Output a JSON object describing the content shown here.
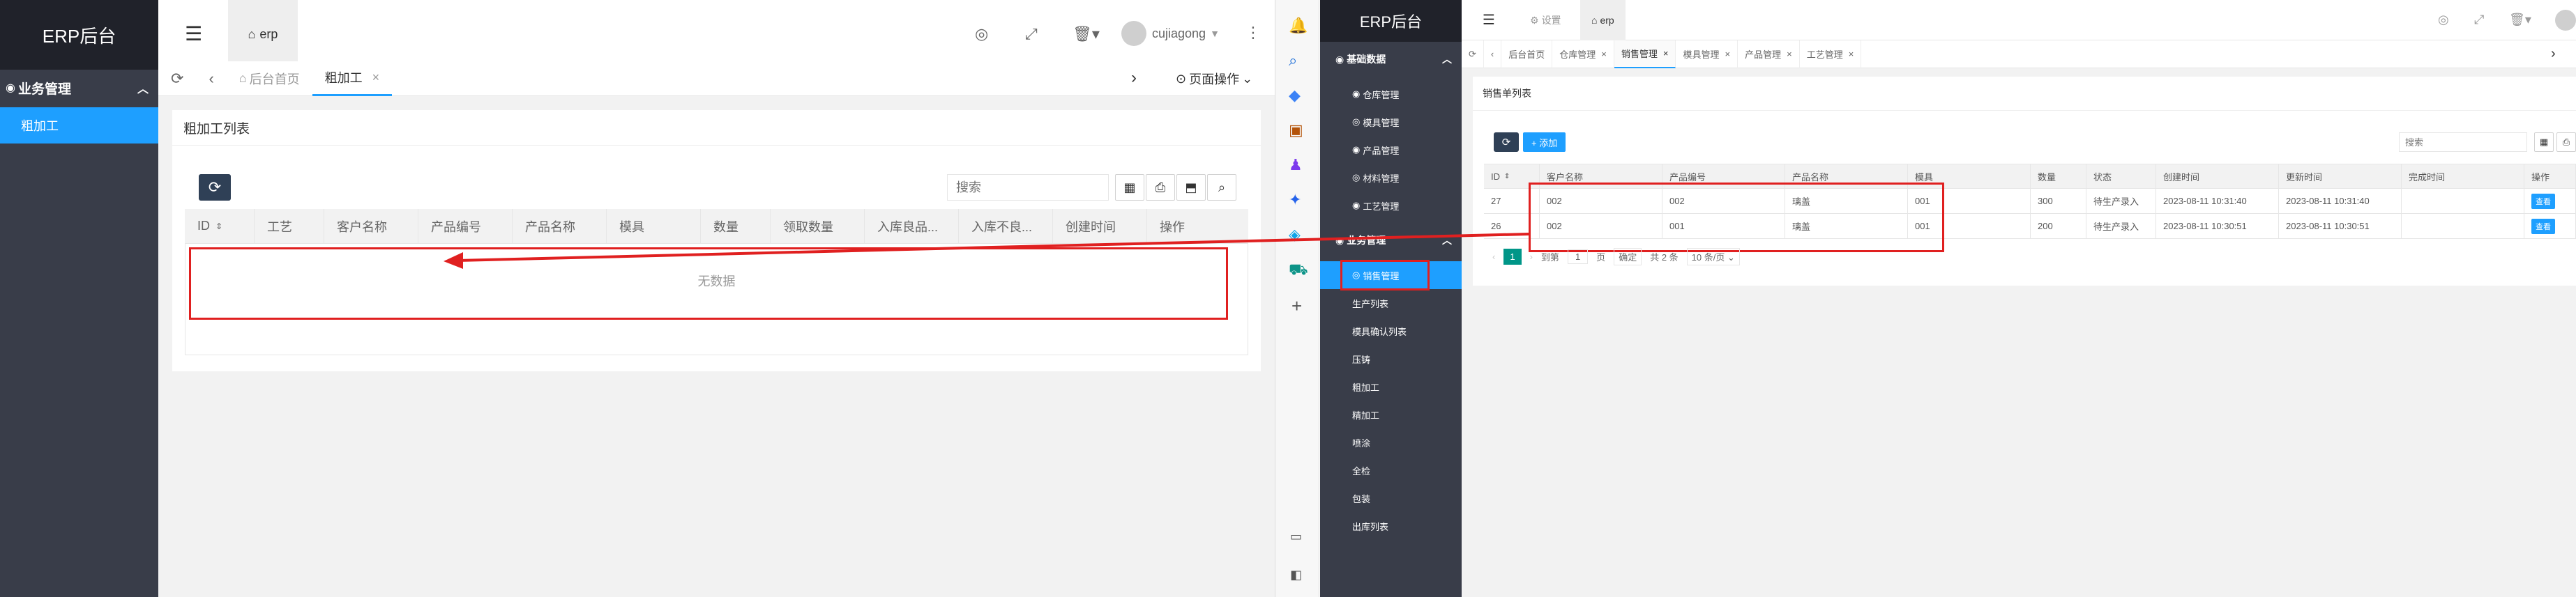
{
  "left": {
    "logo": "ERP后台",
    "sidebar": {
      "group_label": "业务管理",
      "active_item": "粗加工"
    },
    "header": {
      "top_tab": "erp",
      "user_name": "cujiagong"
    },
    "tabs": {
      "home": "后台首页",
      "current": "粗加工",
      "page_ops": "页面操作"
    },
    "card": {
      "title": "粗加工列表",
      "search_placeholder": "搜索"
    },
    "table": {
      "columns": [
        "ID",
        "工艺",
        "客户名称",
        "产品编号",
        "产品名称",
        "模具",
        "数量",
        "领取数量",
        "入库良品...",
        "入库不良...",
        "创建时间",
        "操作"
      ],
      "empty_text": "无数据"
    }
  },
  "right": {
    "logo": "ERP后台",
    "header": {
      "tabs": [
        "设置",
        "erp"
      ]
    },
    "sidebar": {
      "groups": [
        {
          "label": "基础数据",
          "items": [
            "仓库管理",
            "模具管理",
            "产品管理",
            "材料管理",
            "工艺管理"
          ]
        },
        {
          "label": "业务管理",
          "items": [
            "销售管理",
            "生产列表",
            "模具确认列表",
            "压铸",
            "粗加工",
            "精加工",
            "喷涂",
            "全检",
            "包装",
            "出库列表"
          ]
        }
      ]
    },
    "tabs": [
      "后台首页",
      "仓库管理",
      "销售管理",
      "模具管理",
      "产品管理",
      "工艺管理"
    ],
    "card": {
      "title": "销售单列表",
      "add_label": "+ 添加",
      "search_placeholder": "搜索"
    },
    "table": {
      "columns": [
        "ID",
        "客户名称",
        "产品编号",
        "产品名称",
        "模具",
        "数量",
        "状态",
        "创建时间",
        "更新时间",
        "完成时间",
        "操作"
      ],
      "rows": [
        [
          "27",
          "002",
          "002",
          "璃盖",
          "001",
          "300",
          "待生产录入",
          "2023-08-11 10:31:40",
          "2023-08-11 10:31:40",
          "",
          "查看"
        ],
        [
          "26",
          "002",
          "001",
          "璃盖",
          "001",
          "200",
          "待生产录入",
          "2023-08-11 10:30:51",
          "2023-08-11 10:30:51",
          "",
          "查看"
        ]
      ],
      "pager": {
        "current": "1",
        "goto_label": "到第",
        "page_value": "1",
        "page_unit": "页",
        "confirm": "确定",
        "total": "共 2 条",
        "page_size": "10 条/页"
      }
    }
  },
  "colors": {
    "sidebar_bg": "#393d49",
    "logo_bg": "#20222a",
    "accent": "#1e9fff",
    "annotation": "#e02020",
    "refresh_btn": "#2f4056",
    "pager_active": "#009688"
  }
}
